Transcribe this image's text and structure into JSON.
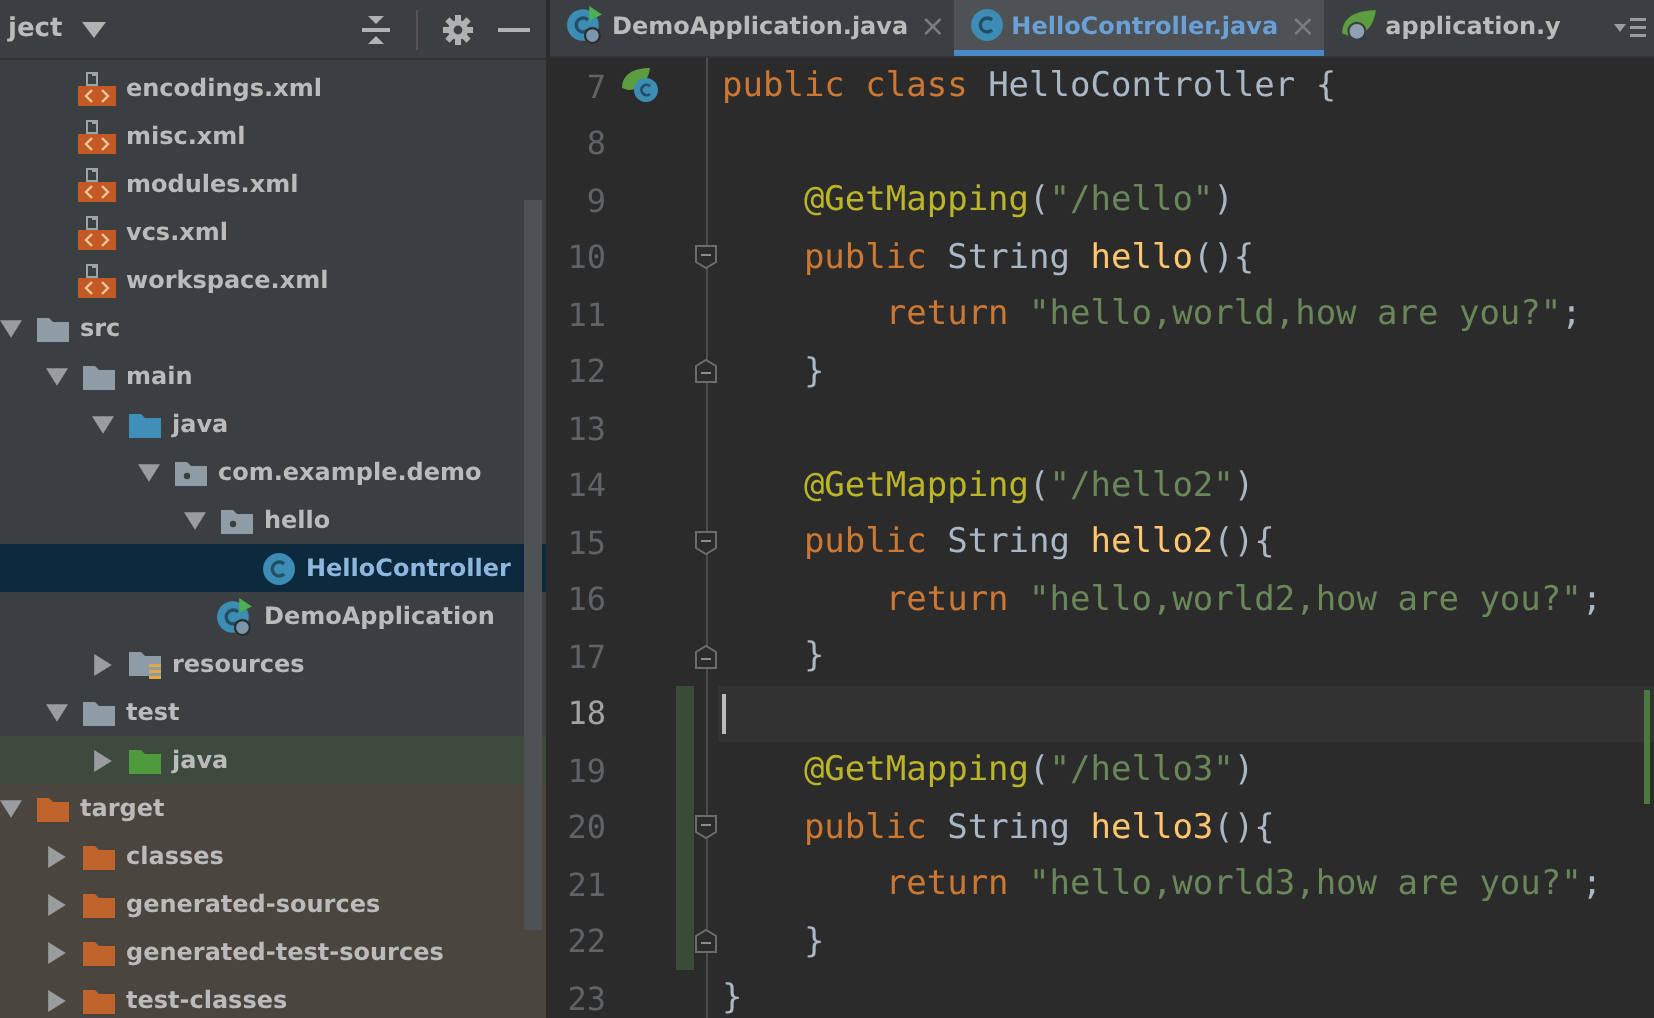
{
  "project_panel": {
    "title": "ject",
    "xml_files": [
      {
        "name": "encodings.xml"
      },
      {
        "name": "misc.xml"
      },
      {
        "name": "modules.xml"
      },
      {
        "name": "vcs.xml"
      },
      {
        "name": "workspace.xml"
      }
    ],
    "tree": [
      {
        "name": "src",
        "kind": "folder",
        "expanded": true,
        "children": [
          {
            "name": "main",
            "kind": "folder",
            "expanded": true,
            "children": [
              {
                "name": "java",
                "kind": "source_root",
                "expanded": true,
                "children": [
                  {
                    "name": "com.example.demo",
                    "kind": "package",
                    "expanded": true,
                    "children": [
                      {
                        "name": "hello",
                        "kind": "package",
                        "expanded": true,
                        "children": [
                          {
                            "name": "HelloController",
                            "kind": "class",
                            "selected": true
                          }
                        ]
                      },
                      {
                        "name": "DemoApplication",
                        "kind": "spring_app",
                        "selected": false
                      }
                    ]
                  }
                ]
              },
              {
                "name": "resources",
                "kind": "resources_root",
                "expanded": false
              }
            ]
          },
          {
            "name": "test",
            "kind": "folder",
            "expanded": true,
            "children": [
              {
                "name": "java",
                "kind": "test_root",
                "expanded": false
              }
            ]
          }
        ]
      },
      {
        "name": "target",
        "kind": "excluded",
        "expanded": true,
        "children": [
          {
            "name": "classes",
            "kind": "excluded",
            "expanded": false
          },
          {
            "name": "generated-sources",
            "kind": "excluded",
            "expanded": false
          },
          {
            "name": "generated-test-sources",
            "kind": "excluded",
            "expanded": false
          },
          {
            "name": "test-classes",
            "kind": "excluded",
            "expanded": false
          }
        ]
      }
    ]
  },
  "tabs": [
    {
      "label": "DemoApplication.java",
      "kind": "spring_app",
      "selected": false,
      "close": "×"
    },
    {
      "label": "HelloController.java",
      "kind": "class",
      "selected": true,
      "close": "×"
    },
    {
      "label": "application.y",
      "kind": "spring_config",
      "selected": false
    }
  ],
  "editor": {
    "lines": [
      {
        "number": "7",
        "kind": "bean",
        "current": false,
        "changed": false,
        "tokens": [
          {
            "kind": "keyword",
            "text": "public class "
          },
          {
            "kind": "plain",
            "text": "HelloController {"
          }
        ]
      },
      {
        "number": "8",
        "kind": "plain",
        "current": false,
        "changed": false
      },
      {
        "number": "9",
        "kind": "plain",
        "current": false,
        "changed": false,
        "tokens": [
          {
            "kind": "annotation",
            "text": "    @GetMapping"
          },
          {
            "kind": "plain",
            "text": "("
          },
          {
            "kind": "string",
            "text": "\"/hello\""
          },
          {
            "kind": "plain",
            "text": ")"
          }
        ]
      },
      {
        "number": "10",
        "kind": "opener",
        "current": false,
        "changed": false,
        "tokens": [
          {
            "kind": "keyword",
            "text": "    public "
          },
          {
            "kind": "plain",
            "text": "String "
          },
          {
            "kind": "method",
            "text": "hello"
          },
          {
            "kind": "plain",
            "text": "(){"
          }
        ]
      },
      {
        "number": "11",
        "kind": "plain",
        "current": false,
        "changed": false,
        "tokens": [
          {
            "kind": "keyword",
            "text": "        return "
          },
          {
            "kind": "string",
            "text": "\"hello,world,how are you?\""
          },
          {
            "kind": "plain",
            "text": ";"
          }
        ]
      },
      {
        "number": "12",
        "kind": "closer",
        "current": false,
        "changed": false,
        "tokens": [
          {
            "kind": "plain",
            "text": "    }"
          }
        ]
      },
      {
        "number": "13",
        "kind": "plain",
        "current": false,
        "changed": false
      },
      {
        "number": "14",
        "kind": "plain",
        "current": false,
        "changed": false,
        "tokens": [
          {
            "kind": "annotation",
            "text": "    @GetMapping"
          },
          {
            "kind": "plain",
            "text": "("
          },
          {
            "kind": "string",
            "text": "\"/hello2\""
          },
          {
            "kind": "plain",
            "text": ")"
          }
        ]
      },
      {
        "number": "15",
        "kind": "opener",
        "current": false,
        "changed": false,
        "tokens": [
          {
            "kind": "keyword",
            "text": "    public "
          },
          {
            "kind": "plain",
            "text": "String "
          },
          {
            "kind": "method",
            "text": "hello2"
          },
          {
            "kind": "plain",
            "text": "(){"
          }
        ]
      },
      {
        "number": "16",
        "kind": "plain",
        "current": false,
        "changed": false,
        "tokens": [
          {
            "kind": "keyword",
            "text": "        return "
          },
          {
            "kind": "string",
            "text": "\"hello,world2,how are you?\""
          },
          {
            "kind": "plain",
            "text": ";"
          }
        ]
      },
      {
        "number": "17",
        "kind": "closer",
        "current": false,
        "changed": false,
        "tokens": [
          {
            "kind": "plain",
            "text": "    }"
          }
        ]
      },
      {
        "number": "18",
        "kind": "plain",
        "current": true,
        "changed": true
      },
      {
        "number": "19",
        "kind": "plain",
        "current": false,
        "changed": true,
        "tokens": [
          {
            "kind": "annotation",
            "text": "    @GetMapping"
          },
          {
            "kind": "plain",
            "text": "("
          },
          {
            "kind": "string",
            "text": "\"/hello3\""
          },
          {
            "kind": "plain",
            "text": ")"
          }
        ]
      },
      {
        "number": "20",
        "kind": "opener",
        "current": false,
        "changed": true,
        "tokens": [
          {
            "kind": "keyword",
            "text": "    public "
          },
          {
            "kind": "plain",
            "text": "String "
          },
          {
            "kind": "method",
            "text": "hello3"
          },
          {
            "kind": "plain",
            "text": "(){"
          }
        ]
      },
      {
        "number": "21",
        "kind": "plain",
        "current": false,
        "changed": true,
        "tokens": [
          {
            "kind": "keyword",
            "text": "        return "
          },
          {
            "kind": "string",
            "text": "\"hello,world3,how are you?\""
          },
          {
            "kind": "plain",
            "text": ";"
          }
        ]
      },
      {
        "number": "22",
        "kind": "closer",
        "current": false,
        "changed": true,
        "tokens": [
          {
            "kind": "plain",
            "text": "    }"
          }
        ]
      },
      {
        "number": "23",
        "kind": "plain",
        "current": false,
        "changed": false,
        "tokens": [
          {
            "kind": "plain",
            "text": "}"
          }
        ]
      }
    ]
  }
}
